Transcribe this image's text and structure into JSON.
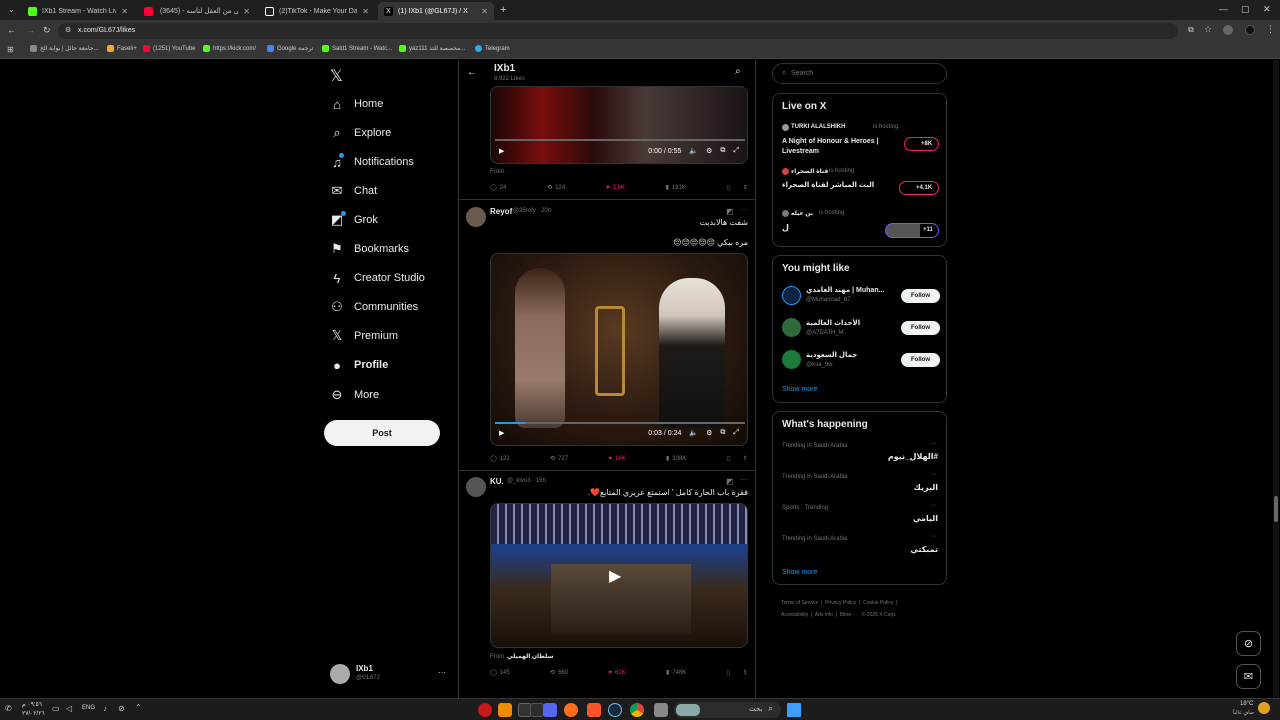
{
  "browser": {
    "tabs": [
      {
        "title": "IXb1 Stream - Watch Live on Ki",
        "color": "#53fc18"
      },
      {
        "title": "أحلى من العقل لتاسه - (3645) ‏",
        "color": "#ff0033"
      },
      {
        "title": "(2)TikTok - Make Your Day",
        "color": "#ffffff"
      },
      {
        "title": "(1) IXb1 (@GL67J) / X",
        "color": "#ffffff"
      }
    ],
    "new_tab": "+",
    "url": "x.com/GL67J/likes",
    "bookmarks": [
      {
        "label": "جامعة حائل | بوابة الخ...",
        "color": "#888888"
      },
      {
        "label": "Faselı+",
        "color": "#f5a623"
      },
      {
        "label": "(1251) YouTube",
        "color": "#ff0033"
      },
      {
        "label": "https://kick.com/",
        "color": "#53fc18"
      },
      {
        "label": "Google ترجمة",
        "color": "#4285f4"
      },
      {
        "label": "Sald1 Stream - Watc...",
        "color": "#53fc18"
      },
      {
        "label": "yaz111 مخصصة للتذ...",
        "color": "#53fc18"
      },
      {
        "label": "Telegram",
        "color": "#2aabee"
      }
    ]
  },
  "nav": {
    "logo": "𝕏",
    "items": [
      {
        "label": "Home",
        "icon": "home-icon",
        "glyph": "⌂"
      },
      {
        "label": "Explore",
        "icon": "search-icon",
        "glyph": "⌕"
      },
      {
        "label": "Notifications",
        "icon": "bell-icon",
        "glyph": "🔔"
      },
      {
        "label": "Chat",
        "icon": "mail-icon",
        "glyph": "✉"
      },
      {
        "label": "Grok",
        "icon": "grok-icon",
        "glyph": "◩"
      },
      {
        "label": "Bookmarks",
        "icon": "bookmark-icon",
        "glyph": "▯"
      },
      {
        "label": "Creator Studio",
        "icon": "bolt-icon",
        "glyph": "⚡"
      },
      {
        "label": "Communities",
        "icon": "people-icon",
        "glyph": "👥"
      },
      {
        "label": "Premium",
        "icon": "x-logo-icon",
        "glyph": "𝕏"
      },
      {
        "label": "Profile",
        "icon": "person-icon",
        "glyph": "👤"
      },
      {
        "label": "More",
        "icon": "more-circle-icon",
        "glyph": "⋯"
      }
    ],
    "post": "Post",
    "account": {
      "name": "IXb1",
      "handle": "@GL67J",
      "more": "···"
    }
  },
  "header": {
    "name": "IXb1",
    "likes": "8,922 Likes"
  },
  "posts": [
    {
      "time": "0:00 / 0:55",
      "from": "From .",
      "replies": "24",
      "reposts": "124",
      "likes": "3.6K",
      "views": "191K"
    },
    {
      "user": "Reyof",
      "handle": "@25rofy · 20h",
      "text1": "شفت هالابديت",
      "text2": "مره بيكي 😔😔😔😔😔",
      "time": "0:03 / 0:24",
      "replies": "122",
      "reposts": "727",
      "likes": "16K",
      "views": "338K"
    },
    {
      "user": "KU.",
      "handle": "@_klvo3 · 15h",
      "text1": "فقرة باب الحارة كامل ' استمتع عزيزي المتابع❤️.",
      "from_label": "From",
      "from_user": "سلطان الهميلي",
      "replies": "145",
      "reposts": "660",
      "likes": "61K",
      "views": "748K"
    }
  ],
  "right": {
    "search_placeholder": "Search",
    "live_title": "Live on X",
    "live": [
      {
        "host": "TURKI ALALSHIKH",
        "status": "is hosting",
        "title": "A Night of Honour & Heroes | Livestream",
        "count": "+8K"
      },
      {
        "host": "قناة الصحراء",
        "status": "is hosting",
        "title": "البث المباشر لقناة الصحراء",
        "count": "+4.1K"
      },
      {
        "host": "بن عيله",
        "status": "is hosting",
        "title": "ل",
        "count": "+11"
      }
    ],
    "wtf_title": "You might like",
    "wtf": [
      {
        "name": "مهند الغامدي | Muhan...",
        "handle": "@Muhannad_b7",
        "follow": "Follow"
      },
      {
        "name": "الأحداث العالمية",
        "handle": "@A7DATH_M",
        "follow": "Follow"
      },
      {
        "name": "جمال السعودية",
        "handle": "@ksa_9w",
        "follow": "Follow"
      }
    ],
    "show_more": "Show more",
    "trend_title": "What's happening",
    "trends": [
      {
        "context": "Trending in Saudi Arabia",
        "name": "#الهلال_نيوم"
      },
      {
        "context": "Trending in Saudi Arabia",
        "name": "البريك"
      },
      {
        "context": "Sports · Trending",
        "name": "اليامي"
      },
      {
        "context": "Trending in Saudi Arabia",
        "name": "تمبكتي"
      }
    ],
    "show_more2": "Show more",
    "footer1": [
      "Terms of Service",
      "Privacy Policy",
      "Cookie Policy"
    ],
    "footer2": [
      "Accessibility",
      "Ads info",
      "More ···",
      "© 2026 X Corp."
    ]
  },
  "taskbar": {
    "lang": "ENG",
    "search": "بحث",
    "weather": "18°C",
    "weather_sub": "صافٍ غالباً",
    "clock_time": "٠٩:٥٦ م",
    "clock_date": "٢٧/٠٢/٢٦"
  }
}
